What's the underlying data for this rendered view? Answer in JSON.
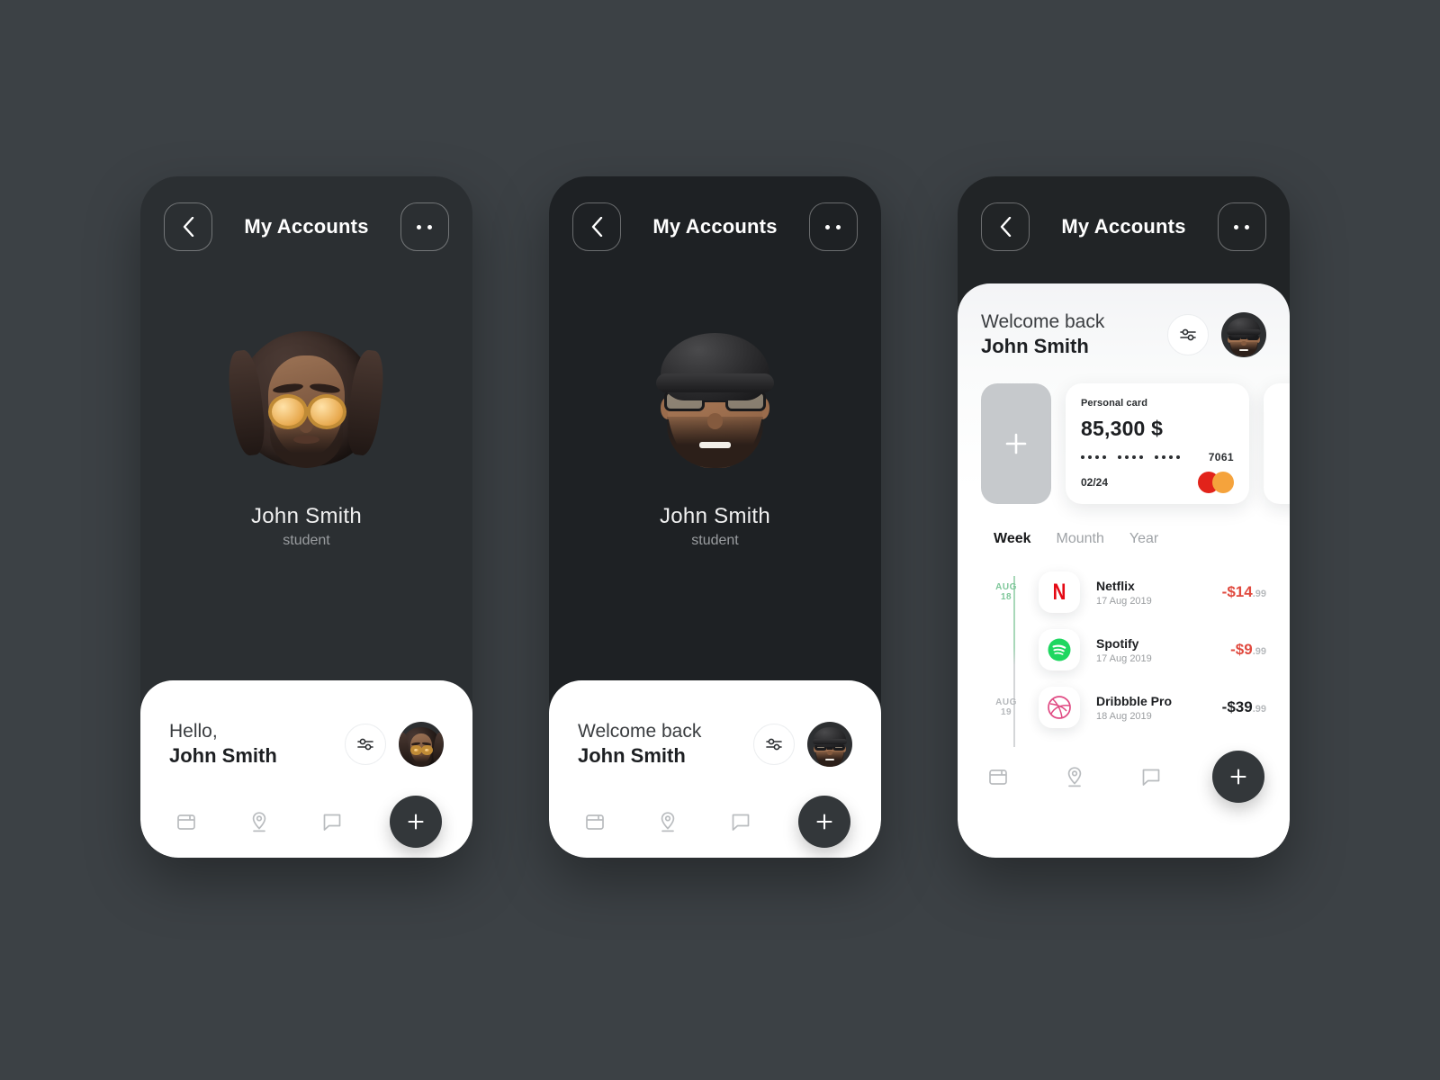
{
  "background_color": "#3c4145",
  "accent": {
    "red": "#e04a3f",
    "green": "#7ec79a",
    "dark": "#33373a"
  },
  "topbar": {
    "title": "My Accounts",
    "back_icon": "chevron-left-icon",
    "more_icon": "more-options-icon"
  },
  "profile": {
    "name": "John Smith",
    "role": "student"
  },
  "screens": [
    {
      "id": "profile-dreadlocks",
      "avatar": "memoji-dreadlocks-sunglasses",
      "greeting_line1": "Hello,",
      "greeting_line2": "John Smith"
    },
    {
      "id": "profile-beanie",
      "avatar": "memoji-beanie-beard-glasses",
      "greeting_line1": "Welcome back",
      "greeting_line2": "John Smith"
    },
    {
      "id": "dashboard",
      "avatar": "memoji-beanie-beard-glasses",
      "greeting_line1": "Welcome back",
      "greeting_line2": "John Smith"
    }
  ],
  "dashboard": {
    "add_card_label": "+",
    "card": {
      "title": "Personal card",
      "balance": "85,300 $",
      "masked_groups": [
        "....",
        "....",
        "...."
      ],
      "last4": "7061",
      "expiry": "02/24",
      "brand": "mastercard-logo"
    },
    "segments": [
      {
        "label": "Week",
        "active": true
      },
      {
        "label": "Mounth",
        "active": false
      },
      {
        "label": "Year",
        "active": false
      }
    ],
    "transactions": [
      {
        "date_badge_month": "AUG",
        "date_badge_day": "18",
        "date_badge_style": "green",
        "icon": "netflix-logo",
        "name": "Netflix",
        "date": "17 Aug 2019",
        "amount_main": "-$14",
        "amount_cents": ".99",
        "amount_style": "red"
      },
      {
        "date_badge_month": "",
        "date_badge_day": "",
        "date_badge_style": "blank",
        "icon": "spotify-logo",
        "name": "Spotify",
        "date": "17 Aug 2019",
        "amount_main": "-$9",
        "amount_cents": ".99",
        "amount_style": "red"
      },
      {
        "date_badge_month": "AUG",
        "date_badge_day": "19",
        "date_badge_style": "gray",
        "icon": "dribbble-logo",
        "name": "Dribbble Pro",
        "date": "18 Aug 2019",
        "amount_main": "-$39",
        "amount_cents": ".99",
        "amount_style": "dark"
      }
    ]
  },
  "bottom_nav": {
    "items": [
      {
        "icon": "wallet-icon"
      },
      {
        "icon": "location-pin-icon"
      },
      {
        "icon": "chat-bubble-icon"
      }
    ],
    "fab_icon": "plus-icon",
    "filter_icon": "filter-sliders-icon"
  }
}
